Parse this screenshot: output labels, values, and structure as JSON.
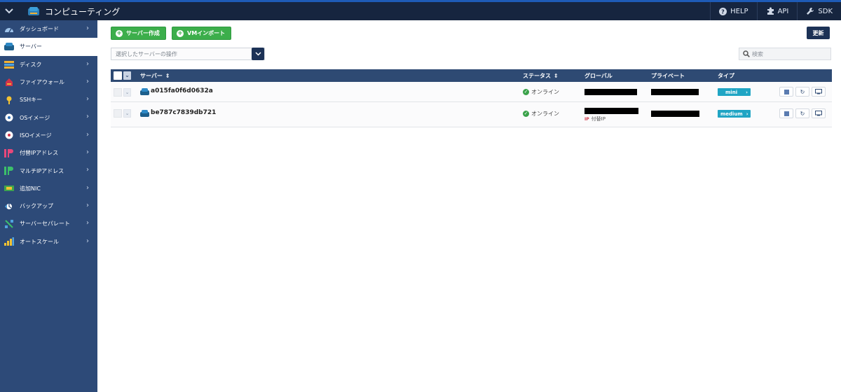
{
  "topbar": {
    "title": "コンピューティング",
    "links": [
      {
        "label": "HELP",
        "icon": "help-icon"
      },
      {
        "label": "API",
        "icon": "puzzle-icon"
      },
      {
        "label": "SDK",
        "icon": "wrench-icon"
      }
    ]
  },
  "sidebar": {
    "items": [
      {
        "label": "ダッシュボード",
        "icon": "dashboard-icon",
        "active": false
      },
      {
        "label": "サーバー",
        "icon": "server-icon",
        "active": true
      },
      {
        "label": "ディスク",
        "icon": "disk-icon",
        "active": false
      },
      {
        "label": "ファイアウォール",
        "icon": "firewall-icon",
        "active": false
      },
      {
        "label": "SSHキー",
        "icon": "key-icon",
        "active": false
      },
      {
        "label": "OSイメージ",
        "icon": "os-image-icon",
        "active": false
      },
      {
        "label": "ISOイメージ",
        "icon": "iso-image-icon",
        "active": false
      },
      {
        "label": "付替IPアドレス",
        "icon": "floating-ip-icon",
        "active": false
      },
      {
        "label": "マルチIPアドレス",
        "icon": "multi-ip-icon",
        "active": false
      },
      {
        "label": "追加NIC",
        "icon": "nic-icon",
        "active": false
      },
      {
        "label": "バックアップ",
        "icon": "backup-icon",
        "active": false
      },
      {
        "label": "サーバーセパレート",
        "icon": "separate-icon",
        "active": false
      },
      {
        "label": "オートスケール",
        "icon": "autoscale-icon",
        "active": false
      }
    ]
  },
  "toolbar": {
    "create_label": "サーバー作成",
    "import_label": "VMインポート",
    "refresh_label": "更新",
    "select_placeholder": "選択したサーバーの操作",
    "search_placeholder": "検索"
  },
  "table": {
    "headers": {
      "server": "サーバー",
      "status": "ステータス",
      "global": "グローバル",
      "private": "プライベート",
      "type": "タイプ"
    },
    "rows": [
      {
        "name": "a015fa0f6d0632a",
        "status": "オンライン",
        "type": "mini",
        "extra_ip": ""
      },
      {
        "name": "be787c7839db721",
        "status": "オンライン",
        "type": "medium",
        "extra_ip": "付替IP"
      }
    ]
  },
  "colors": {
    "topbar": "#16253f",
    "sidebar": "#2d4a78",
    "accent_green": "#3cae4b",
    "table_header": "#2e4a73",
    "type_badge": "#20a5c4"
  }
}
